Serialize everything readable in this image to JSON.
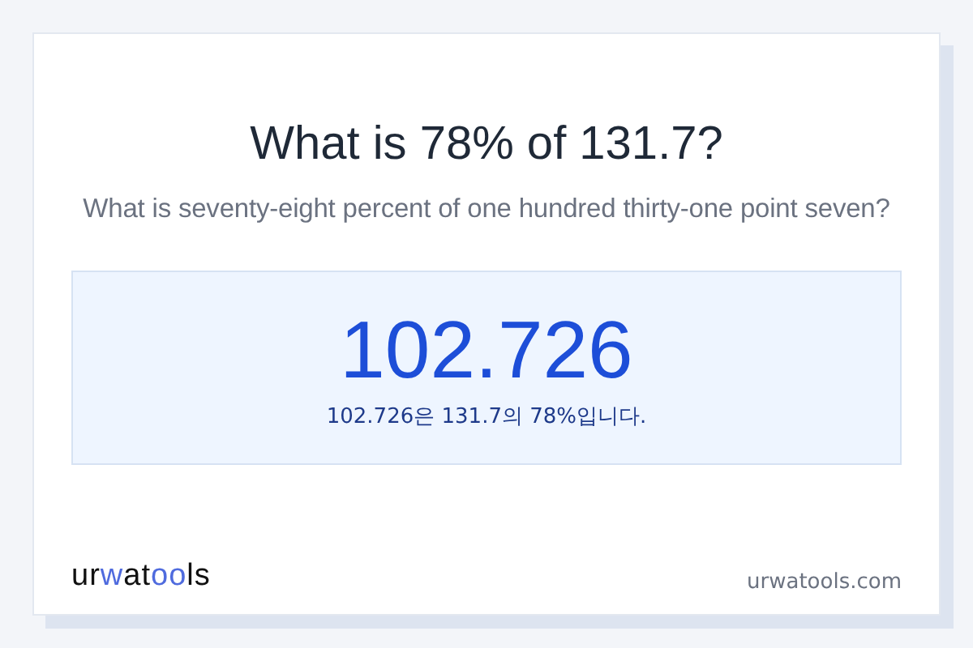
{
  "title": "What is 78% of 131.7?",
  "subtitle": "What is seventy-eight percent of one hundred thirty-one point seven?",
  "result": {
    "value": "102.726",
    "sentence": "102.726은 131.7의 78%입니다."
  },
  "logo": [
    {
      "text": "ur",
      "accent": false
    },
    {
      "text": "w",
      "accent": true
    },
    {
      "text": "at",
      "accent": false
    },
    {
      "text": "oo",
      "accent": true
    },
    {
      "text": "ls",
      "accent": false
    }
  ],
  "site": "urwatools.com"
}
